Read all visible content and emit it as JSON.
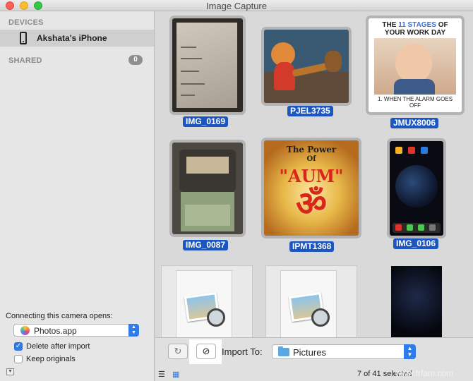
{
  "window": {
    "title": "Image Capture"
  },
  "sidebar": {
    "devices_header": "DEVICES",
    "device_name": "Akshata's iPhone",
    "shared_header": "SHARED",
    "shared_count": "0",
    "connect_label": "Connecting this camera opens:",
    "connect_app": "Photos.app",
    "delete_after_import": {
      "label": "Delete after import",
      "checked": true
    },
    "keep_originals": {
      "label": "Keep originals",
      "checked": false
    }
  },
  "grid": {
    "items": [
      {
        "name": "IMG_0169",
        "selected": true
      },
      {
        "name": "PJEL3735",
        "selected": true
      },
      {
        "name": "JMUX8006",
        "selected": true
      },
      {
        "name": "IMG_0087",
        "selected": true
      },
      {
        "name": "IPMT1368",
        "selected": true
      },
      {
        "name": "IMG_0106",
        "selected": true
      }
    ],
    "meme": {
      "line1a": "THE ",
      "line1b": "11 STAGES",
      "line1c": " OF",
      "line2": "YOUR WORK DAY",
      "caption": "1. WHEN THE ALARM GOES OFF"
    },
    "aum": {
      "line1": "The Power",
      "line2": "Of",
      "line3": "\"AUM\""
    }
  },
  "bottombar": {
    "import_to_label": "Import To:",
    "import_destination": "Pictures",
    "selection_count": "7 of 41 selected"
  },
  "watermark": "www.frfam.com",
  "colors": {
    "accent": "#2f7ce8",
    "selection": "#1c56c0"
  }
}
